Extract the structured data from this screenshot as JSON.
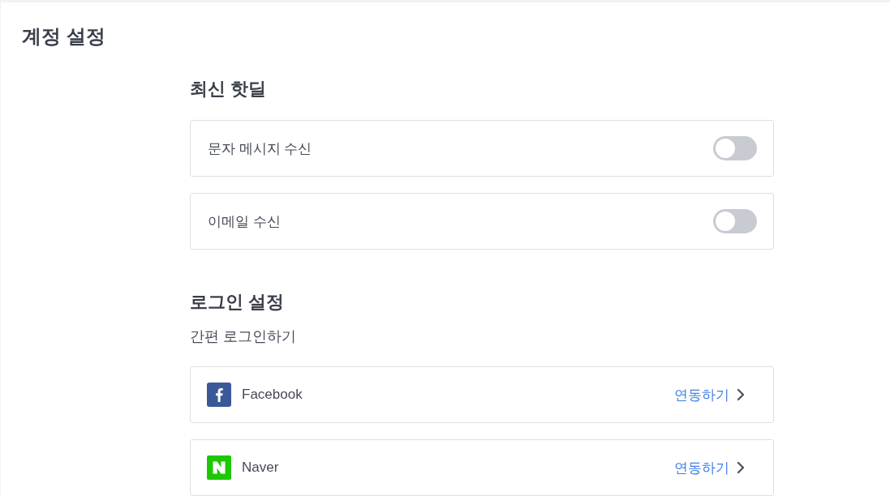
{
  "page": {
    "title": "계정 설정"
  },
  "sections": [
    {
      "heading": "최신 핫딜",
      "items": [
        {
          "kind": "toggle",
          "label": "문자 메시지 수신",
          "on": false
        },
        {
          "kind": "toggle",
          "label": "이메일 수신",
          "on": false
        }
      ]
    },
    {
      "heading": "로그인 설정",
      "subheading": "간편 로그인하기",
      "items": [
        {
          "kind": "facebook",
          "label": "Facebook",
          "action": "연동하기"
        },
        {
          "kind": "naver",
          "label": "Naver",
          "action": "연동하기"
        }
      ]
    }
  ]
}
